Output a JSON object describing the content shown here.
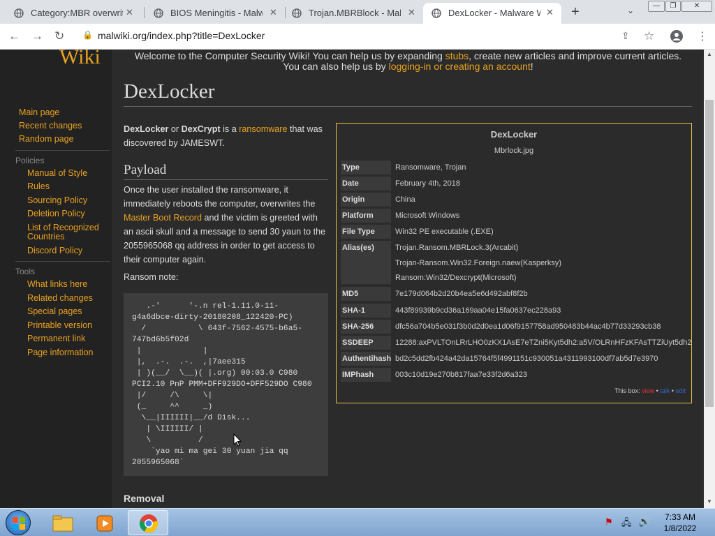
{
  "browser": {
    "tabs": [
      {
        "title": "Category:MBR overwritin",
        "active": false
      },
      {
        "title": "BIOS Meningitis - Malwar",
        "active": false
      },
      {
        "title": "Trojan.MBRBlock - Malwa",
        "active": false
      },
      {
        "title": "DexLocker - Malware Wik",
        "active": true
      }
    ],
    "url": "malwiki.org/index.php?title=DexLocker"
  },
  "sidebar": {
    "logo": "Wiki",
    "nav": [
      "Main page",
      "Recent changes",
      "Random page"
    ],
    "policies_header": "Policies",
    "policies": [
      "Manual of Style",
      "Rules",
      "Sourcing Policy",
      "Deletion Policy",
      "List of Recognized Countries",
      "Discord Policy"
    ],
    "tools_header": "Tools",
    "tools": [
      "What links here",
      "Related changes",
      "Special pages",
      "Printable version",
      "Permanent link",
      "Page information"
    ]
  },
  "notice": {
    "line1_a": "Welcome to the Computer Security Wiki! You can help us by expanding ",
    "line1_link": "stubs",
    "line1_b": ", create new articles and improve current articles.",
    "line2_a": "You can also help us by ",
    "line2_link": "logging-in or creating an account",
    "line2_b": "!"
  },
  "article": {
    "title": "DexLocker",
    "intro_b1": "DexLocker",
    "intro_or": " or ",
    "intro_b2": "DexCrypt",
    "intro_is": " is a ",
    "intro_link": "ransomware",
    "intro_rest": " that was discovered by JAMESWT.",
    "payload_heading": "Payload",
    "payload_a": "Once the user installed the ransomware, it immediately reboots the computer, overwrites the ",
    "payload_link": "Master Boot Record",
    "payload_b": " and the victim is greeted with an ascii skull and a message to send 30 yaun to the 2055965068 qq address in order to get access to their computer again.",
    "ransom_label": "Ransom note:",
    "ransom_note": "   .-'      '-.n rel-1.11.0-11-\ng4a6dbce-dirty-20180208_122420-PC)\n  /           \\ 643f-7562-4575-b6a5-\n747bd6b5f02d\n |             |\n |,  .-.  .-.  ,|7aee315\n | )(__/  \\__)( |.org) 00:03.0 C980\nPCI2.10 PnP PMM+DFF929DO+DFF529DO C980\n |/     /\\     \\|\n (_     ^^     _)\n  \\__|IIIIII|__/d Disk...\n   | \\IIIIII/ |\n   \\          /\n    `yao mi ma gei 30 yuan jia qq\n2055965068`",
    "removal_heading": "Removal"
  },
  "infobox": {
    "title": "DexLocker",
    "image": "Mbrlock.jpg",
    "rows": [
      {
        "key": "Type",
        "vals": [
          "Ransomware, Trojan"
        ]
      },
      {
        "key": "Date",
        "vals": [
          "February 4th, 2018"
        ]
      },
      {
        "key": "Origin",
        "vals": [
          "China"
        ]
      },
      {
        "key": "Platform",
        "vals": [
          "Microsoft Windows"
        ]
      },
      {
        "key": "File Type",
        "vals": [
          "Win32 PE executable (.EXE)"
        ]
      },
      {
        "key": "Alias(es)",
        "vals": [
          "Trojan.Ransom.MBRLock.3(Arcabit)",
          "Trojan-Ransom.Win32.Foreign.naew(Kasperksy)",
          "Ransom:Win32/Dexcrypt(Microsoft)"
        ]
      },
      {
        "key": "MD5",
        "vals": [
          "7e179d064b2d20b4ea5e6d492abf8f2b"
        ]
      },
      {
        "key": "SHA-1",
        "vals": [
          "443f89939b9cd36a169aa04e15fa0637ec228a93"
        ]
      },
      {
        "key": "SHA-256",
        "vals": [
          "dfc56a704b5e031f3b0d2d0ea1d06f9157758ad950483b44ac4b77d33293cb38"
        ]
      },
      {
        "key": "SSDEEP",
        "vals": [
          "12288:axPVLTOnLRrLHO0zKX1AsE7eTZni5Kyt5dh2:a5V/OLRnHFzKFAsTTZiUyt5dh2"
        ]
      },
      {
        "key": "Authentihash",
        "vals": [
          "bd2c5dd2fb424a42da15764f5f4991151c930051a4311993100df7ab5d7e3970"
        ]
      },
      {
        "key": "IMPhash",
        "vals": [
          "003c10d19e270b817faa7e33f2d6a323"
        ]
      }
    ],
    "footer_label": "This box: ",
    "footer_view": "view",
    "footer_talk": "talk",
    "footer_edit": "edit"
  },
  "taskbar": {
    "time": "7:33 AM",
    "date": "1/8/2022"
  }
}
